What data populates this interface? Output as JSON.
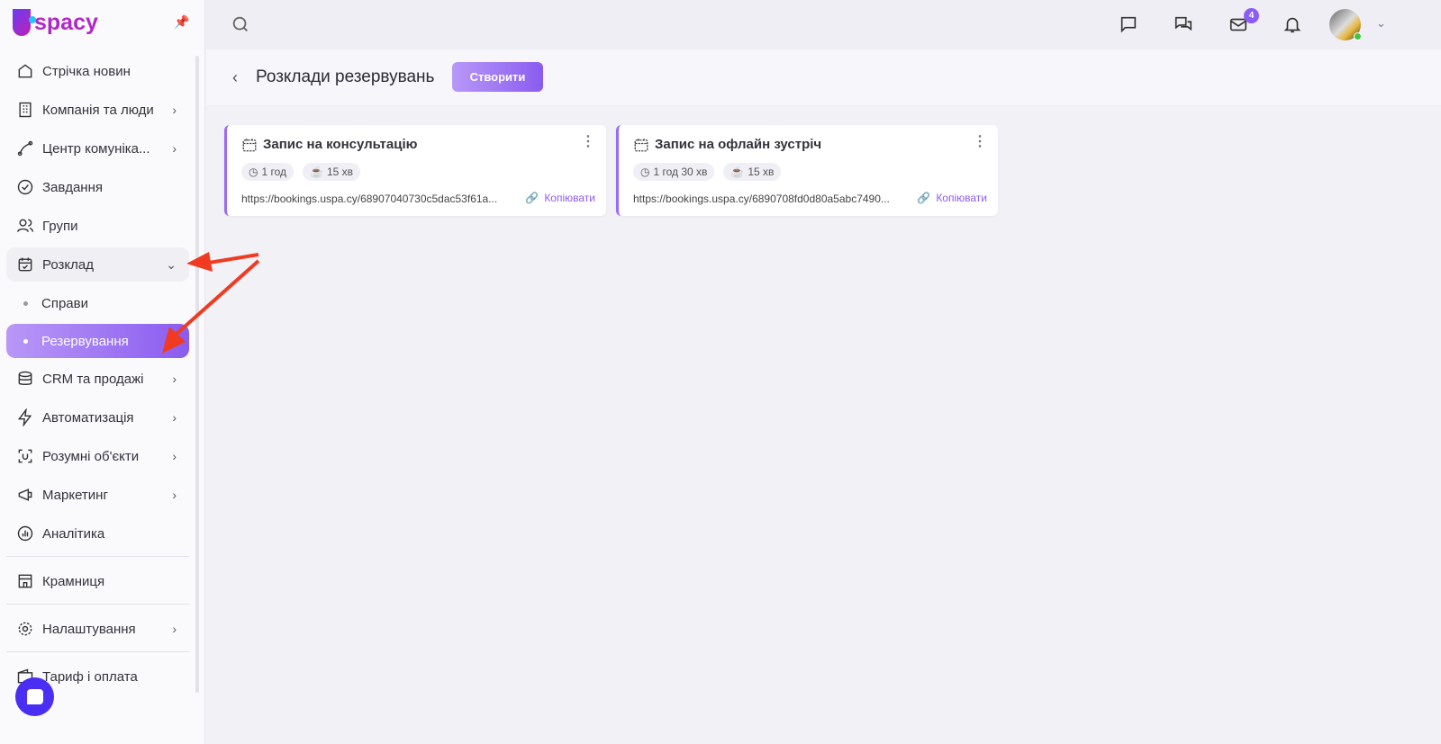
{
  "app": {
    "logo": "uspacy"
  },
  "sidebar": {
    "items": [
      {
        "label": "Стрічка новин",
        "icon": "home-icon"
      },
      {
        "label": "Компанія та люди",
        "icon": "building-icon",
        "chevron": true
      },
      {
        "label": "Центр комуніка...",
        "icon": "communication-icon",
        "chevron": true
      },
      {
        "label": "Завдання",
        "icon": "check-circle-icon"
      },
      {
        "label": "Групи",
        "icon": "users-icon"
      },
      {
        "label": "Розклад",
        "icon": "calendar-check-icon",
        "open": true
      }
    ],
    "sub": [
      {
        "label": "Справи"
      },
      {
        "label": "Резервування",
        "active": true
      }
    ],
    "items2": [
      {
        "label": "CRM та продажі",
        "icon": "database-icon"
      },
      {
        "label": "Автоматизація",
        "icon": "lightning-icon"
      },
      {
        "label": "Розумні об'єкти",
        "icon": "scan-icon"
      },
      {
        "label": "Маркетинг",
        "icon": "megaphone-icon"
      },
      {
        "label": "Аналітика",
        "icon": "chart-icon"
      }
    ],
    "store": "Крамниця",
    "settings": "Налаштування",
    "billing": "Тариф і оплата"
  },
  "header": {
    "mail_badge": "4"
  },
  "page": {
    "title": "Розклади резервувань",
    "create_label": "Створити"
  },
  "cards": [
    {
      "title": "Запис на консультацію",
      "duration": "1 год",
      "break": "15 хв",
      "url": "https://bookings.uspa.cy/68907040730c5dac53f61a...",
      "copy": "Копіювати"
    },
    {
      "title": "Запис на офлайн зустріч",
      "duration": "1 год 30 хв",
      "break": "15 хв",
      "url": "https://bookings.uspa.cy/6890708fd0d80a5abc7490...",
      "copy": "Копіювати"
    }
  ],
  "colors": {
    "accent": "#8b5cf6",
    "annotation": "#f03a22"
  }
}
